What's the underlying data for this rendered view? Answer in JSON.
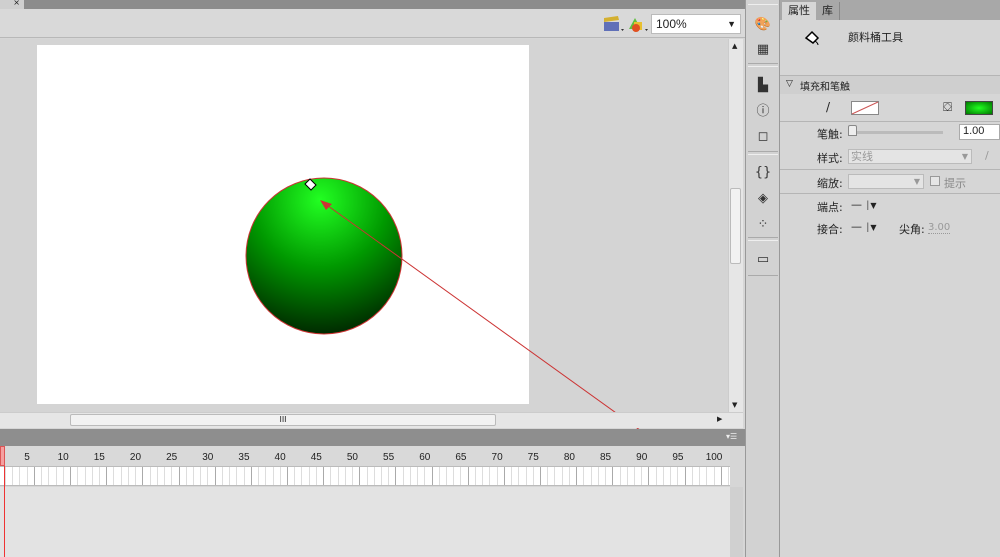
{
  "document": {
    "close_glyph": "×"
  },
  "toolbar": {
    "edit_scene_icon": "clapperboard-icon",
    "edit_symbol_icon": "symbols-icon",
    "zoom_value": "100%"
  },
  "stage": {
    "shape": "circle",
    "fill_gradient": [
      "#22ff22",
      "#009900",
      "#001a00"
    ],
    "stroke_color": "#cc3333"
  },
  "scrollbar": {
    "grip": "III"
  },
  "timeline": {
    "ruler": [
      "5",
      "10",
      "15",
      "20",
      "25",
      "30",
      "35",
      "40",
      "45",
      "50",
      "55",
      "60",
      "65",
      "70",
      "75",
      "80",
      "85",
      "90",
      "95",
      "100"
    ]
  },
  "toolstrip": {
    "icons": [
      "palette-icon",
      "swatches-icon",
      "align-icon",
      "info-icon",
      "transform-icon",
      "actions-icon",
      "components-icon",
      "motion-presets-icon",
      "project-icon"
    ]
  },
  "properties": {
    "tabs": [
      "属性",
      "库"
    ],
    "tool_name": "颜料桶工具",
    "section": "填充和笔触",
    "stroke_label": "笔触:",
    "stroke_value": "1.00",
    "style_label": "样式:",
    "style_value": "实线",
    "scale_label": "缩放:",
    "hint_label": "提示",
    "cap_label": "端点:",
    "join_label": "接合:",
    "cap_value": "—",
    "join_value": "—",
    "miter_label": "尖角:",
    "miter_value": "3.00",
    "fill_color": "#00cc00"
  }
}
